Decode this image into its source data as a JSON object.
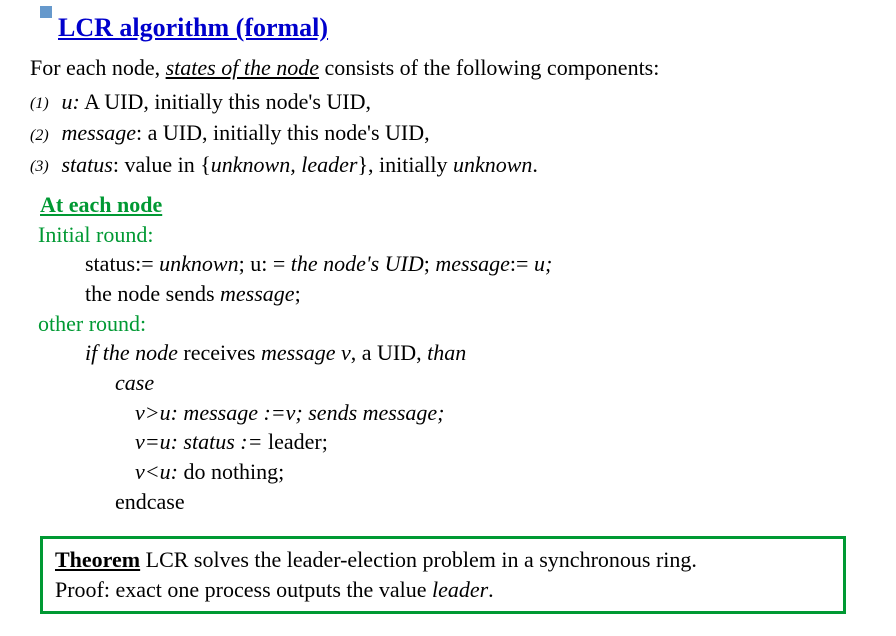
{
  "title": "LCR algorithm (formal)",
  "intro": {
    "prefix": "For each node, ",
    "states_phrase": "states of the node",
    "suffix": " consists of the following components:"
  },
  "items": {
    "n1": "(1)",
    "c1_term": "u:",
    "c1_text": " A UID, initially this node's UID,",
    "n2": "(2)",
    "c2_term": "message",
    "c2_text": ": a UID, initially this node's UID,",
    "n3": "(3)",
    "c3_term": "status",
    "c3_text1": ": value in {",
    "c3_text2": "unknown, leader",
    "c3_text3": "}, initially ",
    "c3_text4": "unknown",
    "c3_text5": "."
  },
  "heading2": "At each node",
  "initial_label": "Initial round:",
  "initial_line1_a": "status:= ",
  "initial_line1_b": "unknown",
  "initial_line1_c": "; u: = ",
  "initial_line1_d": "the node's UID",
  "initial_line1_e": "; ",
  "initial_line1_f": "message",
  "initial_line1_g": ":= ",
  "initial_line1_h": "u;",
  "initial_line2_a": "the node sends ",
  "initial_line2_b": "message",
  "initial_line2_c": ";",
  "other_label": "other round:",
  "other_line1_a": "if the node",
  "other_line1_b": " receives ",
  "other_line1_c": "message v",
  "other_line1_d": ", a UID, ",
  "other_line1_e": "than",
  "case": "case",
  "case1_a": "v>u: message :=v; sends message;",
  "case2_a": "v=u: status :=",
  "case2_b": " leader;",
  "case3_a": "v<u:",
  "case3_b": " do nothing;",
  "endcase": "endcase",
  "theorem": {
    "label": "Theorem",
    "text": "  LCR solves the leader-election problem in a synchronous ring.",
    "proof_a": "Proof: exact one process outputs the value ",
    "proof_b": "leader",
    "proof_c": "."
  }
}
